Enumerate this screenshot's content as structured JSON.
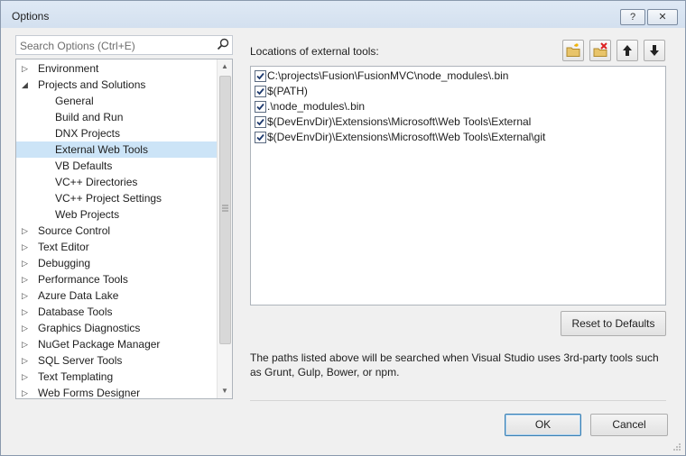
{
  "window": {
    "title": "Options",
    "help_label": "?",
    "close_label": "✕"
  },
  "search": {
    "placeholder": "Search Options (Ctrl+E)"
  },
  "tree": {
    "items": [
      {
        "label": "Environment",
        "expanded": false,
        "level": 0,
        "selected": false
      },
      {
        "label": "Projects and Solutions",
        "expanded": true,
        "level": 0,
        "selected": false
      },
      {
        "label": "General",
        "level": 1,
        "selected": false
      },
      {
        "label": "Build and Run",
        "level": 1,
        "selected": false
      },
      {
        "label": "DNX Projects",
        "level": 1,
        "selected": false
      },
      {
        "label": "External Web Tools",
        "level": 1,
        "selected": true
      },
      {
        "label": "VB Defaults",
        "level": 1,
        "selected": false
      },
      {
        "label": "VC++ Directories",
        "level": 1,
        "selected": false
      },
      {
        "label": "VC++ Project Settings",
        "level": 1,
        "selected": false
      },
      {
        "label": "Web Projects",
        "level": 1,
        "selected": false
      },
      {
        "label": "Source Control",
        "expanded": false,
        "level": 0,
        "selected": false
      },
      {
        "label": "Text Editor",
        "expanded": false,
        "level": 0,
        "selected": false
      },
      {
        "label": "Debugging",
        "expanded": false,
        "level": 0,
        "selected": false
      },
      {
        "label": "Performance Tools",
        "expanded": false,
        "level": 0,
        "selected": false
      },
      {
        "label": "Azure Data Lake",
        "expanded": false,
        "level": 0,
        "selected": false
      },
      {
        "label": "Database Tools",
        "expanded": false,
        "level": 0,
        "selected": false
      },
      {
        "label": "Graphics Diagnostics",
        "expanded": false,
        "level": 0,
        "selected": false
      },
      {
        "label": "NuGet Package Manager",
        "expanded": false,
        "level": 0,
        "selected": false
      },
      {
        "label": "SQL Server Tools",
        "expanded": false,
        "level": 0,
        "selected": false
      },
      {
        "label": "Text Templating",
        "expanded": false,
        "level": 0,
        "selected": false
      },
      {
        "label": "Web Forms Designer",
        "expanded": false,
        "level": 0,
        "selected": false
      }
    ]
  },
  "locations": {
    "label": "Locations of external tools:",
    "toolbar": [
      "new-folder-icon",
      "delete-icon",
      "arrow-up-icon",
      "arrow-down-icon"
    ],
    "paths": [
      {
        "checked": true,
        "path": "C:\\projects\\Fusion\\FusionMVC\\node_modules\\.bin"
      },
      {
        "checked": true,
        "path": "$(PATH)"
      },
      {
        "checked": true,
        "path": ".\\node_modules\\.bin"
      },
      {
        "checked": true,
        "path": "$(DevEnvDir)\\Extensions\\Microsoft\\Web Tools\\External"
      },
      {
        "checked": true,
        "path": "$(DevEnvDir)\\Extensions\\Microsoft\\Web Tools\\External\\git"
      }
    ]
  },
  "reset_label": "Reset to Defaults",
  "description": "The paths listed above will be searched when Visual Studio uses 3rd-party tools such as Grunt, Gulp, Bower, or npm.",
  "ok_label": "OK",
  "cancel_label": "Cancel",
  "colors": {
    "selection": "#cce4f7",
    "titlebar": "#d3e0ef",
    "primary_border": "#3c7fb1"
  }
}
